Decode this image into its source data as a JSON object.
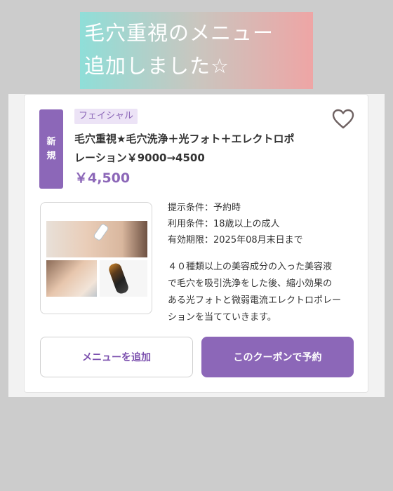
{
  "banner": {
    "line1": "毛穴重視のメニュー",
    "line2": "追加しました☆"
  },
  "coupon": {
    "badge": [
      "新",
      "規"
    ],
    "category": "フェイシャル",
    "title_line1": "毛穴重視★毛穴洗浄＋光フォト＋エレクトロポ",
    "title_line2": "レーション￥9000→4500",
    "price": "￥4,500",
    "conditions": [
      "提示条件：予約時",
      "利用条件：18歳以上の成人",
      "有効期限：2025年08月末日まで"
    ],
    "description": [
      "４０種類以上の美容成分の入った美容液",
      "で毛穴を吸引洗浄をした後、縮小効果の",
      "ある光フォトと微弱電流エレクトロポレー",
      "ションを当てていきます。"
    ],
    "favorite_icon": "heart-outline-icon",
    "image_alt": "facial treatment photos"
  },
  "actions": {
    "add_menu": "メニューを追加",
    "reserve": "このクーポンで予約"
  },
  "colors": {
    "accent": "#8c67b8",
    "accent_light": "#ece3f6"
  }
}
